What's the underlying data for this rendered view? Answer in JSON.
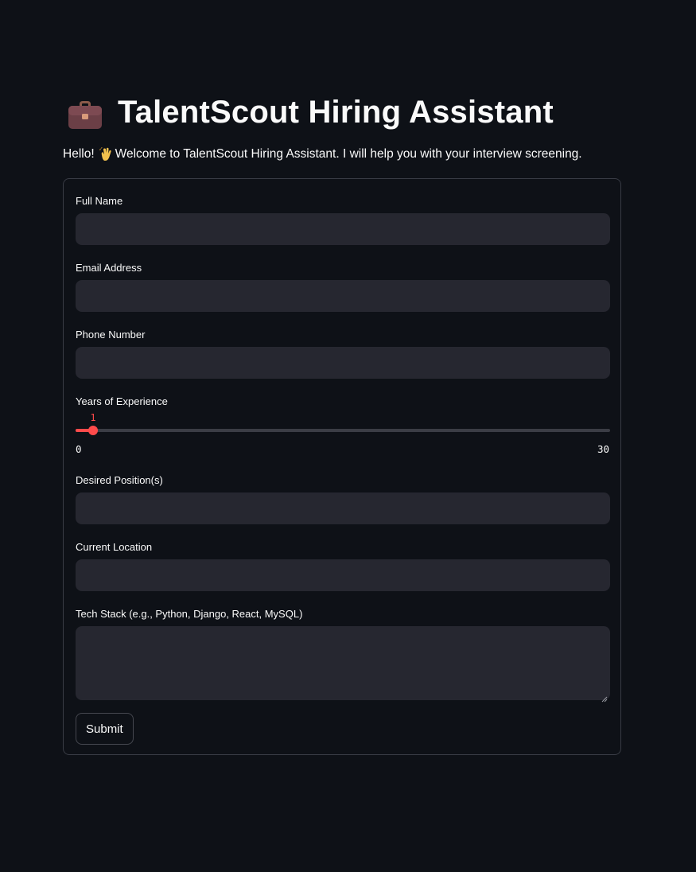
{
  "header": {
    "title": "TalentScout Hiring Assistant",
    "icon": "briefcase-icon"
  },
  "welcome": {
    "prefix": "Hello!",
    "emoji": "waving-hand-icon",
    "message": "Welcome to TalentScout Hiring Assistant. I will help you with your interview screening."
  },
  "form": {
    "full_name": {
      "label": "Full Name",
      "value": ""
    },
    "email": {
      "label": "Email Address",
      "value": ""
    },
    "phone": {
      "label": "Phone Number",
      "value": ""
    },
    "experience": {
      "label": "Years of Experience",
      "value": "1",
      "min": "0",
      "max": "30",
      "fraction": 0.0333
    },
    "position": {
      "label": "Desired Position(s)",
      "value": ""
    },
    "location": {
      "label": "Current Location",
      "value": ""
    },
    "tech_stack": {
      "label": "Tech Stack (e.g., Python, Django, React, MySQL)",
      "value": ""
    },
    "submit_label": "Submit"
  },
  "colors": {
    "background": "#0e1117",
    "input_background": "#262730",
    "accent": "#ff4b4b",
    "border": "#393c45"
  }
}
